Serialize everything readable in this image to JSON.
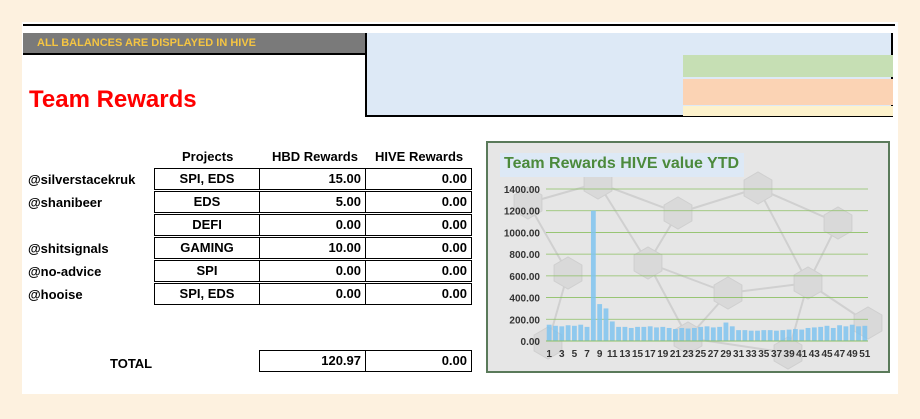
{
  "banner": "ALL BALANCES ARE DISPLAYED IN HIVE",
  "title": "Team Rewards",
  "columns": {
    "projects": "Projects",
    "hbd": "HBD Rewards",
    "hive": "HIVE Rewards"
  },
  "rows": [
    {
      "user": "@silverstacekruk",
      "project": "SPI, EDS",
      "hbd": "15.00",
      "hive": "0.00"
    },
    {
      "user": "@shanibeer",
      "project": "EDS",
      "hbd": "5.00",
      "hive": "0.00"
    },
    {
      "user": "",
      "project": "DEFI",
      "hbd": "0.00",
      "hive": "0.00"
    },
    {
      "user": "@shitsignals",
      "project": "GAMING",
      "hbd": "10.00",
      "hive": "0.00"
    },
    {
      "user": "@no-advice",
      "project": "SPI",
      "hbd": "0.00",
      "hive": "0.00"
    },
    {
      "user": "@hooise",
      "project": "SPI, EDS",
      "hbd": "0.00",
      "hive": "0.00"
    }
  ],
  "total": {
    "label": "TOTAL",
    "hbd": "120.97",
    "hive": "0.00"
  },
  "colors": {
    "title": "#ff0000",
    "banner_text": "#f5c542",
    "chart_title": "#4c8a3c",
    "bar": "#7fc3ee"
  },
  "chart_data": {
    "type": "bar",
    "title": "Team Rewards HIVE value YTD",
    "ylim": [
      0,
      1400
    ],
    "yticks": [
      "0.00",
      "200.00",
      "400.00",
      "600.00",
      "800.00",
      "1000.00",
      "1200.00",
      "1400.00"
    ],
    "xtick_labels": [
      "1",
      "3",
      "5",
      "7",
      "9",
      "11",
      "13",
      "15",
      "17",
      "19",
      "21",
      "23",
      "25",
      "27",
      "29",
      "31",
      "33",
      "35",
      "37",
      "39",
      "41",
      "43",
      "45",
      "47",
      "49",
      "51"
    ],
    "x": [
      1,
      2,
      3,
      4,
      5,
      6,
      7,
      8,
      9,
      10,
      11,
      12,
      13,
      14,
      15,
      16,
      17,
      18,
      19,
      20,
      21,
      22,
      23,
      24,
      25,
      26,
      27,
      28,
      29,
      30,
      31,
      32,
      33,
      34,
      35,
      36,
      37,
      38,
      39,
      40,
      41,
      42,
      43,
      44,
      45,
      46,
      47,
      48,
      49,
      50,
      51
    ],
    "values": [
      150,
      140,
      135,
      145,
      140,
      150,
      130,
      1200,
      340,
      300,
      180,
      130,
      130,
      120,
      130,
      130,
      135,
      125,
      130,
      120,
      110,
      120,
      115,
      120,
      130,
      135,
      125,
      130,
      170,
      135,
      100,
      100,
      95,
      95,
      100,
      100,
      95,
      100,
      105,
      110,
      105,
      120,
      125,
      130,
      140,
      120,
      145,
      135,
      150,
      135,
      140
    ],
    "grid": true,
    "legend": "none"
  }
}
